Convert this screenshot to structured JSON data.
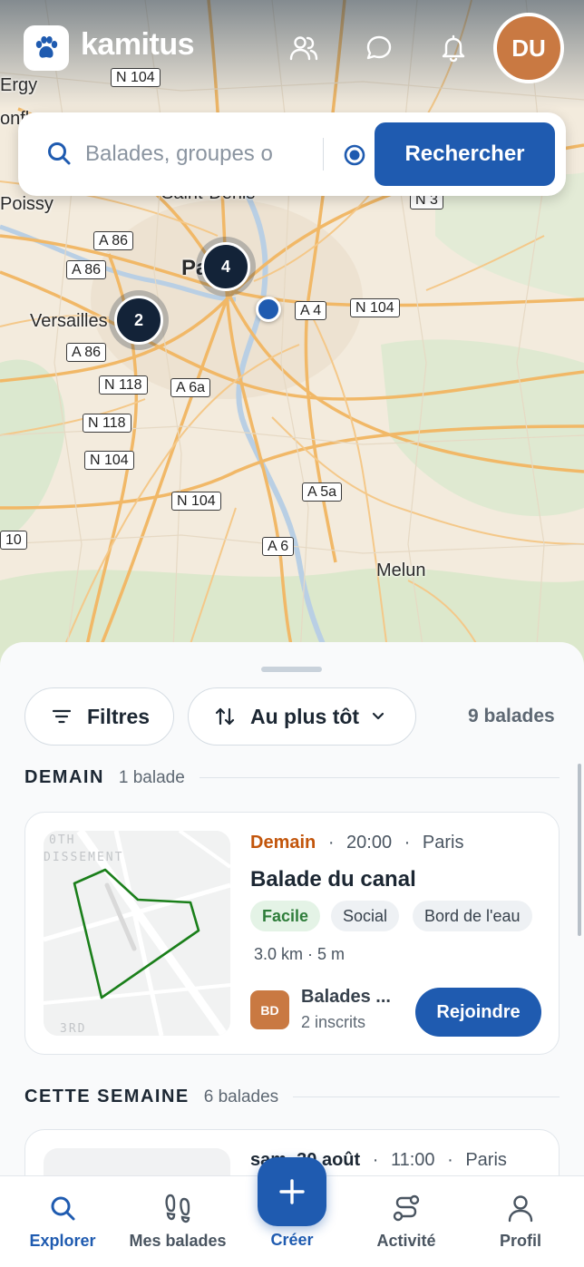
{
  "app": {
    "name": "kamitus",
    "avatar_initials": "DU"
  },
  "header": {
    "icons": [
      "groups-icon",
      "chat-icon",
      "bell-icon"
    ]
  },
  "search": {
    "placeholder": "Balades, groupes o",
    "button_label": "Rechercher"
  },
  "map": {
    "places": [
      "Ergy",
      "onfl",
      "Poissy",
      "Saint-Denis",
      "Pa",
      "Versailles",
      "Melun"
    ],
    "roads": [
      "N 104",
      "A 86",
      "A 86",
      "A 86",
      "A 4",
      "N 104",
      "N 118",
      "A 6a",
      "N 118",
      "N 104",
      "N 104",
      "A 5a",
      "A 6",
      "10",
      "N 3"
    ],
    "clusters": [
      {
        "count": "4"
      },
      {
        "count": "2"
      }
    ]
  },
  "filters": {
    "filter_label": "Filtres",
    "sort_label": "Au plus tôt",
    "results_count": "9 balades"
  },
  "sections": [
    {
      "title": "DEMAIN",
      "count": "1 balade"
    },
    {
      "title": "CETTE SEMAINE",
      "count": "6 balades"
    }
  ],
  "cards": [
    {
      "map_text_top": "0TH",
      "map_text_mid": "DISSEMENT",
      "map_text_bottom": "3RD",
      "when": "Demain",
      "time": "20:00",
      "city": "Paris",
      "title": "Balade du canal",
      "tags": [
        "Facile",
        "Social",
        "Bord de l'eau"
      ],
      "stats": "3.0 km · 5 m",
      "organizer_initials": "BD",
      "organizer_name": "Balades ...",
      "participants": "2 inscrits",
      "join_label": "Rejoindre",
      "route_color": "#1a7f1a"
    },
    {
      "when": "sam. 30 août",
      "time": "11:00",
      "city": "Paris"
    }
  ],
  "nav": [
    {
      "label": "Explorer",
      "icon": "search-icon",
      "active": true
    },
    {
      "label": "Mes balades",
      "icon": "footprints-icon",
      "active": false
    },
    {
      "label": "Créer",
      "icon": "plus-icon",
      "active": false
    },
    {
      "label": "Activité",
      "icon": "activity-icon",
      "active": false
    },
    {
      "label": "Profil",
      "icon": "user-icon",
      "active": false
    }
  ],
  "colors": {
    "primary": "#1f5bb0",
    "accent": "#c2550b",
    "avatar": "#c97942"
  }
}
